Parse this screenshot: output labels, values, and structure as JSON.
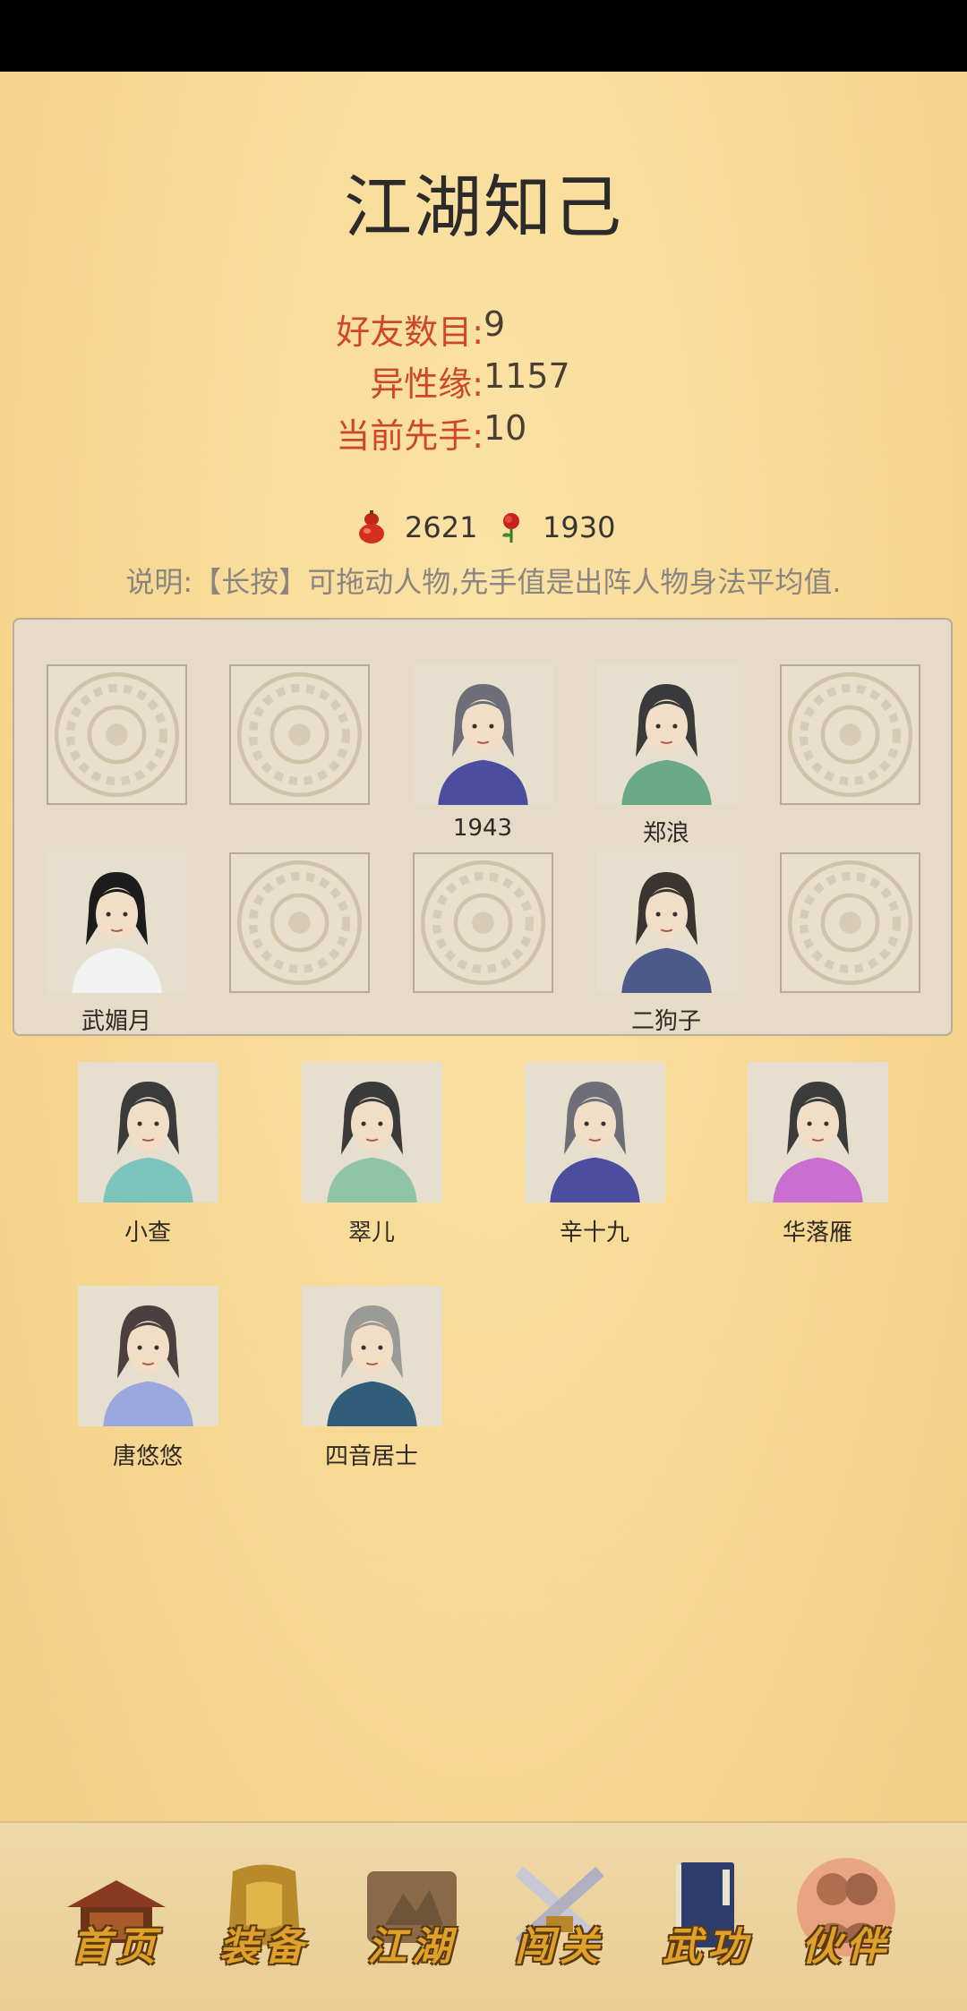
{
  "page": {
    "title": "江湖知己"
  },
  "stats": [
    {
      "label": "好友数目:",
      "value": "9"
    },
    {
      "label": "异性缘:",
      "value": "1157"
    },
    {
      "label": "当前先手:",
      "value": "10"
    }
  ],
  "currency": [
    {
      "icon": "red-gourd-icon",
      "value": "2621"
    },
    {
      "icon": "rose-icon",
      "value": "1930"
    }
  ],
  "note": "说明:【长按】可拖动人物,先手值是出阵人物身法平均值.",
  "formation": {
    "slots": [
      {
        "name": "",
        "empty": true
      },
      {
        "name": "",
        "empty": true
      },
      {
        "name": "1943",
        "empty": false,
        "icon": "swordsman-portrait"
      },
      {
        "name": "郑浪",
        "empty": false,
        "icon": "woman-portrait"
      },
      {
        "name": "",
        "empty": true
      },
      {
        "name": "武媚月",
        "empty": false,
        "icon": "flute-player-portrait"
      },
      {
        "name": "",
        "empty": true
      },
      {
        "name": "",
        "empty": true
      },
      {
        "name": "二狗子",
        "empty": false,
        "icon": "man-portrait"
      },
      {
        "name": "",
        "empty": true
      }
    ]
  },
  "friends": [
    {
      "name": "小查",
      "icon": "girl-portrait"
    },
    {
      "name": "翠儿",
      "icon": "maid-portrait"
    },
    {
      "name": "辛十九",
      "icon": "swordsman-portrait"
    },
    {
      "name": "华落雁",
      "icon": "lady-portrait"
    },
    {
      "name": "唐悠悠",
      "icon": "girl-headband-portrait"
    },
    {
      "name": "四音居士",
      "icon": "elder-portrait"
    }
  ],
  "nav": [
    {
      "label": "首页",
      "icon": "pavilion-icon"
    },
    {
      "label": "装备",
      "icon": "armor-icon"
    },
    {
      "label": "江湖",
      "icon": "scroll-map-icon"
    },
    {
      "label": "闯关",
      "icon": "crossed-swords-icon"
    },
    {
      "label": "武功",
      "icon": "martial-book-icon"
    },
    {
      "label": "伙伴",
      "icon": "partners-icon",
      "active": true
    }
  ],
  "colors": {
    "accent_label": "#cc4630",
    "background": "#f7d892",
    "nav_text": "#e0a12a"
  }
}
